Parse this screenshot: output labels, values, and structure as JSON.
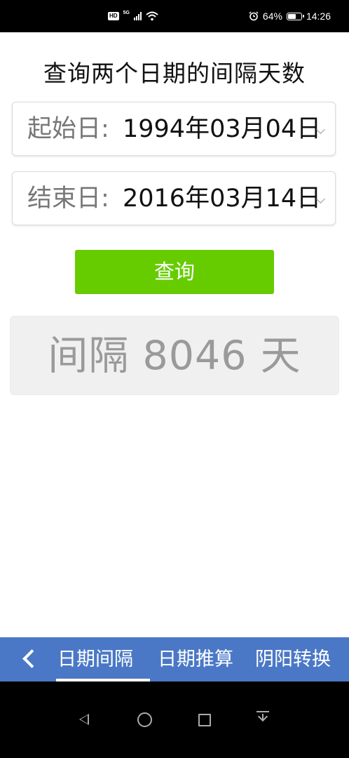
{
  "status_bar": {
    "hd": "HD",
    "network": "5G",
    "battery_percent": "64%",
    "battery_level": 0.64,
    "time": "14:26",
    "icons": [
      "hd-icon",
      "signal-icon",
      "wifi-icon",
      "alarm-icon",
      "battery-icon"
    ]
  },
  "page": {
    "title": "查询两个日期的间隔天数"
  },
  "start_date": {
    "label": "起始日:",
    "value": "1994年03月04日"
  },
  "end_date": {
    "label": "结束日:",
    "value": "2016年03月14日"
  },
  "query_button": {
    "label": "查询",
    "color": "#66cc00"
  },
  "result": {
    "text": "间隔 8046 天"
  },
  "tabbar": {
    "color": "#4a78c6",
    "tabs": [
      {
        "label": "日期间隔",
        "active": true
      },
      {
        "label": "日期推算",
        "active": false
      },
      {
        "label": "阴阳转换",
        "active": false
      }
    ]
  },
  "nav": {
    "icons": [
      "back-icon",
      "home-icon",
      "recents-icon",
      "notification-down-icon"
    ]
  }
}
